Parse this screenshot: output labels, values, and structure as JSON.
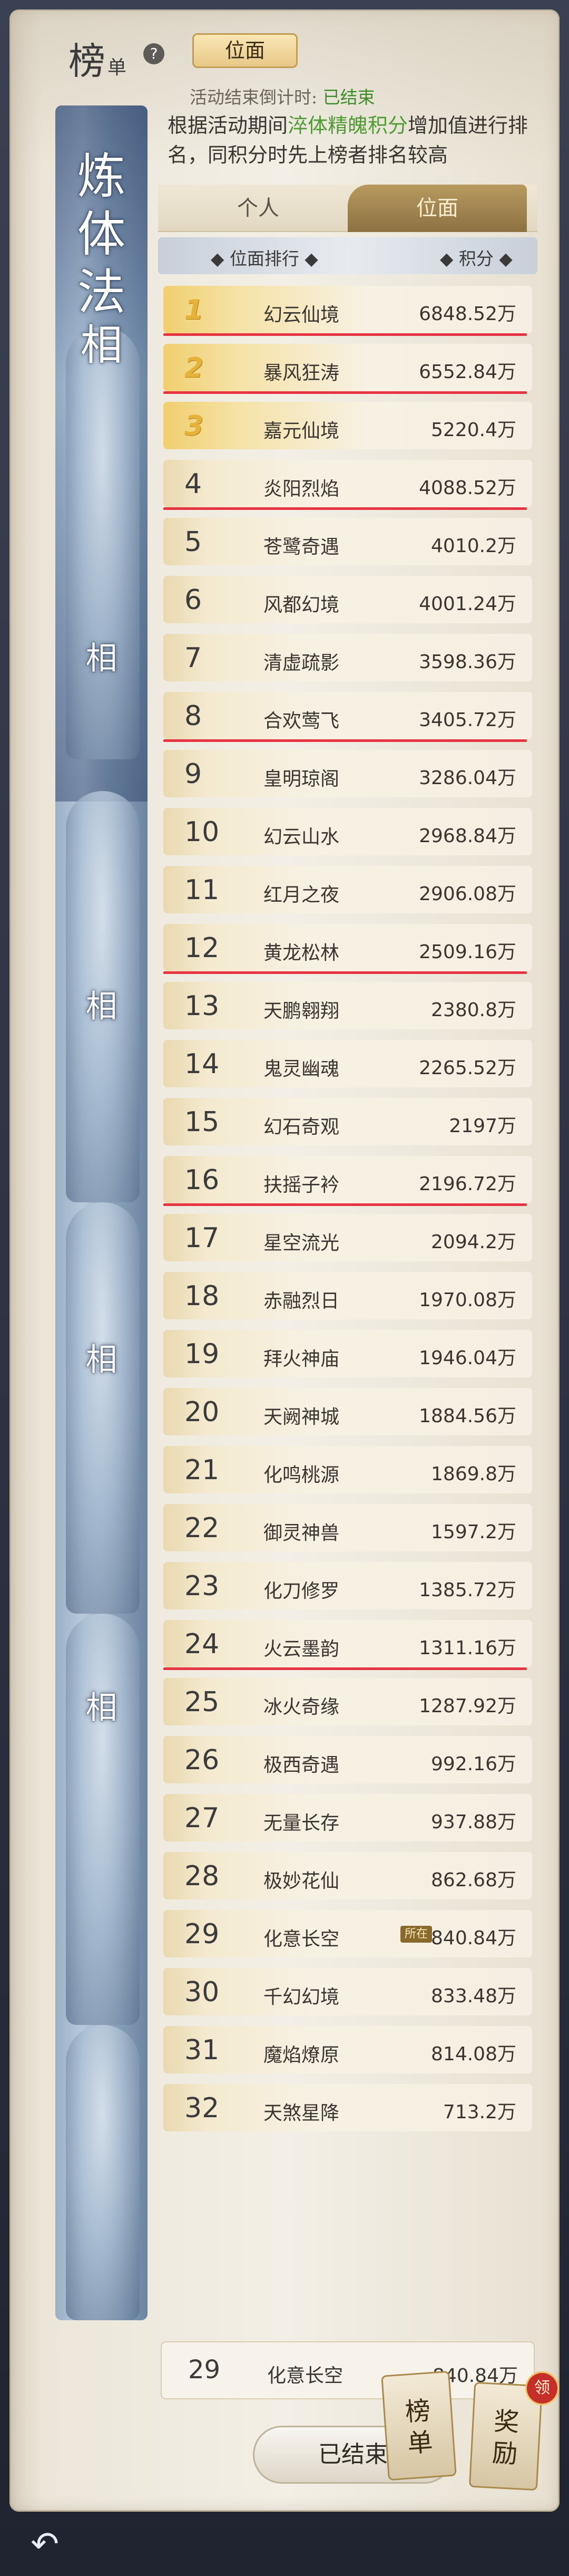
{
  "header": {
    "title_main": "榜",
    "title_sub": "单",
    "help_icon": "?",
    "top_tab_label": "位面"
  },
  "countdown": {
    "label": "活动结束倒计时:",
    "status": "已结束"
  },
  "description": {
    "prefix": "根据活动期间",
    "highlight": "淬体精魄积分",
    "suffix": "增加值进行排名，同积分时先上榜者排名较高"
  },
  "left_strip": {
    "chars": [
      "炼",
      "体",
      "法",
      "相",
      "相",
      "相",
      "相",
      "相"
    ]
  },
  "subtabs": {
    "personal": "个人",
    "plane": "位面"
  },
  "list_header": {
    "rank": "位面排行",
    "score": "积分"
  },
  "rows": [
    {
      "rank": "1",
      "name": "幻云仙境",
      "score": "6848.52",
      "unit": "万",
      "underline": true,
      "medal": true
    },
    {
      "rank": "2",
      "name": "暴风狂涛",
      "score": "6552.84",
      "unit": "万",
      "underline": true,
      "medal": true
    },
    {
      "rank": "3",
      "name": "嘉元仙境",
      "score": "5220.4",
      "unit": "万",
      "underline": false,
      "medal": true
    },
    {
      "rank": "4",
      "name": "炎阳烈焰",
      "score": "4088.52",
      "unit": "万",
      "underline": true,
      "medal": false
    },
    {
      "rank": "5",
      "name": "苍鹭奇遇",
      "score": "4010.2",
      "unit": "万",
      "underline": false,
      "medal": false
    },
    {
      "rank": "6",
      "name": "风都幻境",
      "score": "4001.24",
      "unit": "万",
      "underline": false,
      "medal": false
    },
    {
      "rank": "7",
      "name": "清虚疏影",
      "score": "3598.36",
      "unit": "万",
      "underline": false,
      "medal": false
    },
    {
      "rank": "8",
      "name": "合欢莺飞",
      "score": "3405.72",
      "unit": "万",
      "underline": true,
      "medal": false
    },
    {
      "rank": "9",
      "name": "皇明琼阁",
      "score": "3286.04",
      "unit": "万",
      "underline": false,
      "medal": false
    },
    {
      "rank": "10",
      "name": "幻云山水",
      "score": "2968.84",
      "unit": "万",
      "underline": false,
      "medal": false
    },
    {
      "rank": "11",
      "name": "红月之夜",
      "score": "2906.08",
      "unit": "万",
      "underline": false,
      "medal": false
    },
    {
      "rank": "12",
      "name": "黄龙松林",
      "score": "2509.16",
      "unit": "万",
      "underline": true,
      "medal": false
    },
    {
      "rank": "13",
      "name": "天鹏翱翔",
      "score": "2380.8",
      "unit": "万",
      "underline": false,
      "medal": false
    },
    {
      "rank": "14",
      "name": "鬼灵幽魂",
      "score": "2265.52",
      "unit": "万",
      "underline": false,
      "medal": false
    },
    {
      "rank": "15",
      "name": "幻石奇观",
      "score": "2197",
      "unit": "万",
      "underline": false,
      "medal": false
    },
    {
      "rank": "16",
      "name": "扶摇子衿",
      "score": "2196.72",
      "unit": "万",
      "underline": true,
      "medal": false
    },
    {
      "rank": "17",
      "name": "星空流光",
      "score": "2094.2",
      "unit": "万",
      "underline": false,
      "medal": false
    },
    {
      "rank": "18",
      "name": "赤融烈日",
      "score": "1970.08",
      "unit": "万",
      "underline": false,
      "medal": false
    },
    {
      "rank": "19",
      "name": "拜火神庙",
      "score": "1946.04",
      "unit": "万",
      "underline": false,
      "medal": false
    },
    {
      "rank": "20",
      "name": "天阙神城",
      "score": "1884.56",
      "unit": "万",
      "underline": false,
      "medal": false
    },
    {
      "rank": "21",
      "name": "化鸣桃源",
      "score": "1869.8",
      "unit": "万",
      "underline": false,
      "medal": false
    },
    {
      "rank": "22",
      "name": "御灵神兽",
      "score": "1597.2",
      "unit": "万",
      "underline": false,
      "medal": false
    },
    {
      "rank": "23",
      "name": "化刀修罗",
      "score": "1385.72",
      "unit": "万",
      "underline": false,
      "medal": false
    },
    {
      "rank": "24",
      "name": "火云墨韵",
      "score": "1311.16",
      "unit": "万",
      "underline": true,
      "medal": false
    },
    {
      "rank": "25",
      "name": "冰火奇缘",
      "score": "1287.92",
      "unit": "万",
      "underline": false,
      "medal": false
    },
    {
      "rank": "26",
      "name": "极西奇遇",
      "score": "992.16",
      "unit": "万",
      "underline": false,
      "medal": false
    },
    {
      "rank": "27",
      "name": "无量长存",
      "score": "937.88",
      "unit": "万",
      "underline": false,
      "medal": false
    },
    {
      "rank": "28",
      "name": "极妙花仙",
      "score": "862.68",
      "unit": "万",
      "underline": false,
      "medal": false
    },
    {
      "rank": "29",
      "name": "化意长空",
      "score": "840.84",
      "unit": "万",
      "underline": false,
      "medal": false,
      "badge": "所在"
    },
    {
      "rank": "30",
      "name": "千幻幻境",
      "score": "833.48",
      "unit": "万",
      "underline": false,
      "medal": false
    },
    {
      "rank": "31",
      "name": "魔焰燎原",
      "score": "814.08",
      "unit": "万",
      "underline": false,
      "medal": false
    },
    {
      "rank": "32",
      "name": "天煞星降",
      "score": "713.2",
      "unit": "万",
      "underline": false,
      "medal": false
    }
  ],
  "my_row": {
    "rank": "29",
    "name": "化意长空",
    "score": "840.84",
    "unit": "万"
  },
  "ended_button": "已结束",
  "bottom_tabs": {
    "board_chars": [
      "榜",
      "单"
    ],
    "reward_chars": [
      "奖",
      "励"
    ],
    "claim_badge": "领"
  },
  "icons": {
    "help": "help-icon",
    "back": "back-arrow-icon"
  },
  "colors": {
    "highlight_green": "#4f9a34",
    "underline_red": "#e63444",
    "medal_gold": "#e5b23a"
  }
}
